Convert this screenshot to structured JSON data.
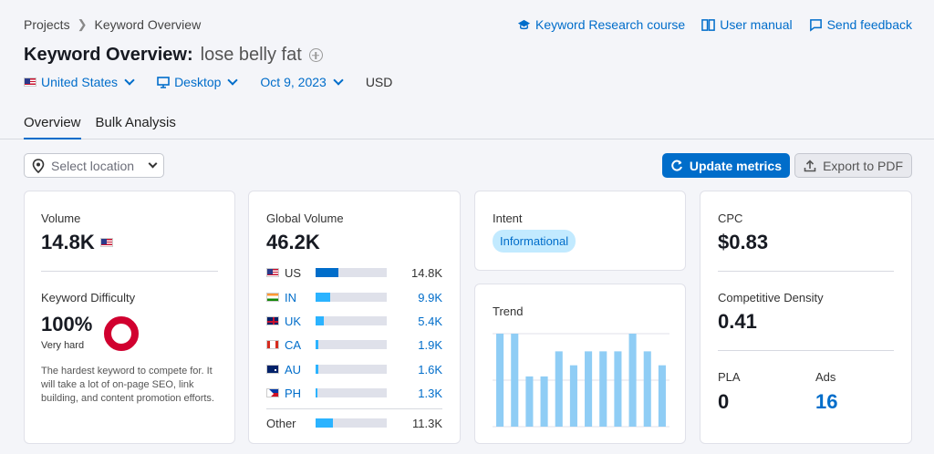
{
  "breadcrumb": {
    "root": "Projects",
    "current": "Keyword Overview"
  },
  "top_links": [
    {
      "label": "Keyword Research course",
      "icon": "graduation-cap-icon"
    },
    {
      "label": "User manual",
      "icon": "book-icon"
    },
    {
      "label": "Send feedback",
      "icon": "feedback-icon"
    }
  ],
  "title": {
    "prefix": "Keyword Overview:",
    "keyword": "lose belly fat"
  },
  "filters": {
    "country": "United States",
    "device": "Desktop",
    "date": "Oct 9, 2023",
    "currency": "USD"
  },
  "tabs": [
    {
      "label": "Overview",
      "active": true
    },
    {
      "label": "Bulk Analysis",
      "active": false
    }
  ],
  "toolbar": {
    "location_placeholder": "Select location",
    "update_label": "Update metrics",
    "export_label": "Export to PDF"
  },
  "volume": {
    "label": "Volume",
    "value": "14.8K"
  },
  "kd": {
    "label": "Keyword Difficulty",
    "value": "100%",
    "level": "Very hard",
    "percent": 100,
    "description": "The hardest keyword to compete for. It will take a lot of on-page SEO, link building, and content promotion efforts."
  },
  "global_volume": {
    "label": "Global Volume",
    "value": "46.2K",
    "rows": [
      {
        "code": "US",
        "value": "14.8K",
        "share": 0.32
      },
      {
        "code": "IN",
        "value": "9.9K",
        "share": 0.21
      },
      {
        "code": "UK",
        "value": "5.4K",
        "share": 0.12
      },
      {
        "code": "CA",
        "value": "1.9K",
        "share": 0.04
      },
      {
        "code": "AU",
        "value": "1.6K",
        "share": 0.035
      },
      {
        "code": "PH",
        "value": "1.3K",
        "share": 0.03
      }
    ],
    "other": {
      "label": "Other",
      "value": "11.3K",
      "share": 0.24
    }
  },
  "intent": {
    "label": "Intent",
    "badge": "Informational"
  },
  "trend": {
    "label": "Trend",
    "values": [
      1.0,
      1.0,
      0.54,
      0.54,
      0.81,
      0.66,
      0.81,
      0.81,
      0.81,
      1.0,
      0.81,
      0.66
    ]
  },
  "cpc": {
    "label": "CPC",
    "value": "$0.83"
  },
  "competitive_density": {
    "label": "Competitive Density",
    "value": "0.41"
  },
  "pla": {
    "label": "PLA",
    "value": "0"
  },
  "ads": {
    "label": "Ads",
    "value": "16"
  },
  "colors": {
    "accent": "#006dca",
    "kd_ring": "#d1002f",
    "bar": "#2bb3ff",
    "trend_bar": "#8fcdf5"
  }
}
